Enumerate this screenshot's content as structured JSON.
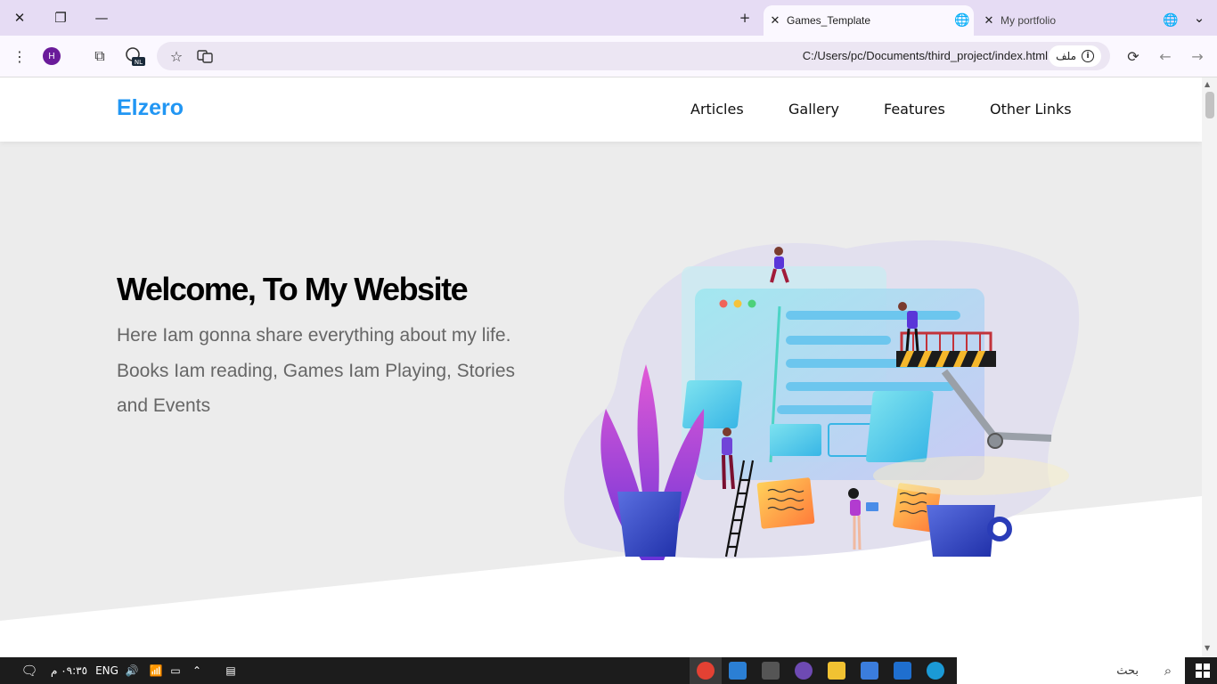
{
  "browser": {
    "tabs": [
      {
        "title": "Games_Template",
        "active": true
      },
      {
        "title": "My portfolio",
        "active": false
      }
    ],
    "url": "C:/Users/pc/Documents/third_project/index.html",
    "url_chip": "ملف",
    "profile_letter": "H",
    "extension_badge": "NL"
  },
  "site": {
    "logo": "Elzero",
    "nav": [
      "Articles",
      "Gallery",
      "Features",
      "Other Links"
    ],
    "hero": {
      "title": "Welcome, To My Website",
      "text": "Here Iam gonna share everything about my life. Books Iam reading, Games Iam Playing, Stories and Events"
    }
  },
  "taskbar": {
    "time": "٠٩:٣٥ م",
    "lang": "ENG",
    "search_label": "بحث"
  },
  "colors": {
    "accent": "#2196f3",
    "tabbar": "#e6dcf4",
    "landing_bg": "#ececec"
  }
}
